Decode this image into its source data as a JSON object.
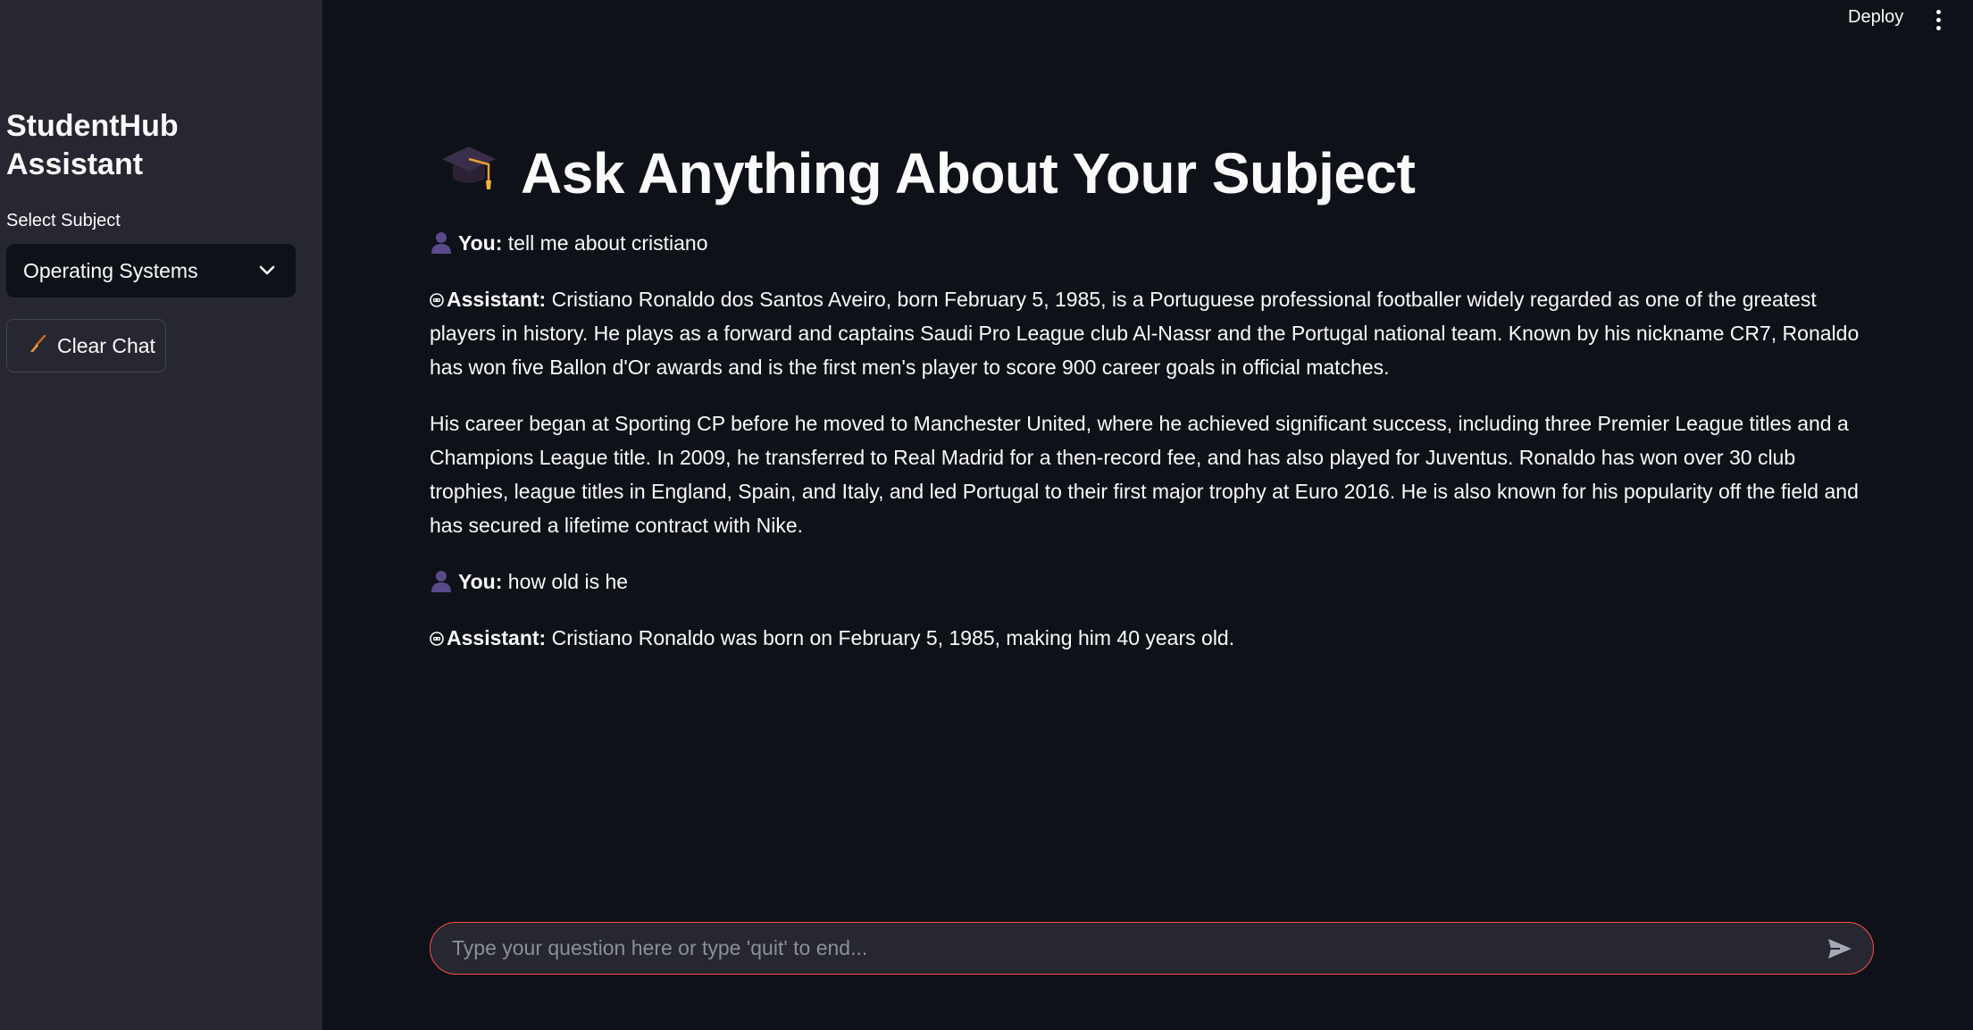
{
  "sidebar": {
    "title": "StudentHub Assistant",
    "select_label": "Select Subject",
    "selected_subject": "Operating Systems",
    "clear_button": "Clear Chat"
  },
  "header": {
    "deploy_label": "Deploy"
  },
  "main": {
    "title": "Ask Anything About Your Subject",
    "messages": [
      {
        "role_label": "You:",
        "text": "tell me about cristiano"
      },
      {
        "role_label": "Assistant:",
        "text": "Cristiano Ronaldo dos Santos Aveiro, born February 5, 1985, is a Portuguese professional footballer widely regarded as one of the greatest players in history. He plays as a forward and captains Saudi Pro League club Al-Nassr and the Portugal national team. Known by his nickname CR7, Ronaldo has won five Ballon d'Or awards and is the first men's player to score 900 career goals in official matches.",
        "text2": "His career began at Sporting CP before he moved to Manchester United, where he achieved significant success, including three Premier League titles and a Champions League title. In 2009, he transferred to Real Madrid for a then-record fee, and has also played for Juventus. Ronaldo has won over 30 club trophies, league titles in England, Spain, and Italy, and led Portugal to their first major trophy at Euro 2016. He is also known for his popularity off the field and has secured a lifetime contract with Nike."
      },
      {
        "role_label": "You:",
        "text": "how old is he"
      },
      {
        "role_label": "Assistant:",
        "text": "Cristiano Ronaldo was born on February 5, 1985, making him 40 years old."
      }
    ]
  },
  "chat_input": {
    "placeholder": "Type your question here or type 'quit' to end...",
    "value": ""
  },
  "colors": {
    "background": "#0e1117",
    "sidebar": "#262730",
    "accent": "#ff4b4b",
    "text": "#fafafa"
  },
  "icons": [
    "graduation-cap-icon",
    "user-icon",
    "robot-icon",
    "broom-icon",
    "chevron-down-icon",
    "send-icon",
    "more-vertical-icon"
  ]
}
